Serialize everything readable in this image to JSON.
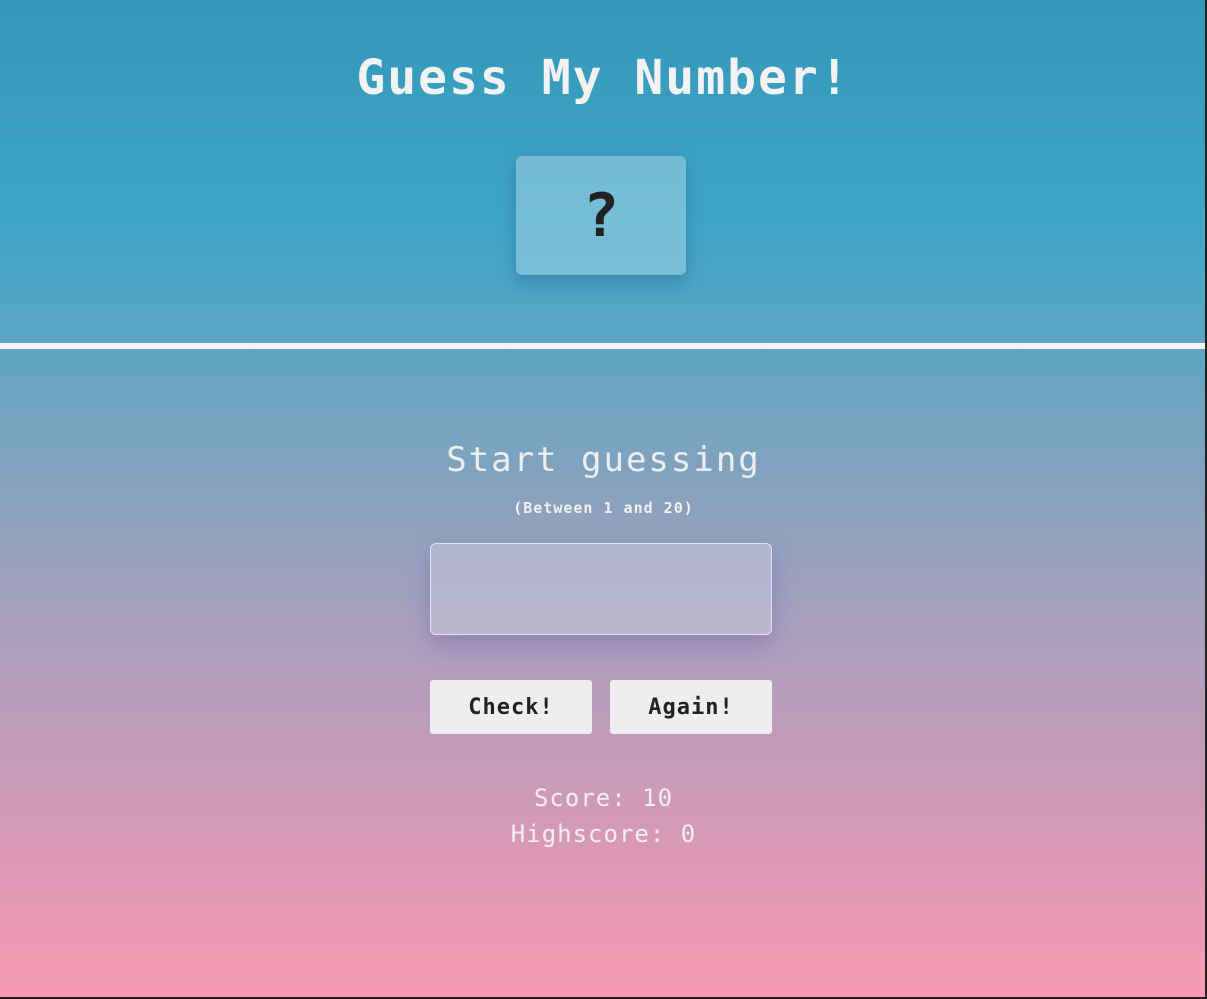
{
  "header": {
    "title": "Guess My Number!",
    "secret_number_display": "?"
  },
  "main": {
    "message": "Start guessing",
    "range_hint": "(Between 1 and 20)",
    "guess_input": {
      "value": "",
      "placeholder": ""
    },
    "buttons": {
      "check_label": "Check!",
      "again_label": "Again!"
    },
    "stats": {
      "score_label": "Score:",
      "score_value": "10",
      "highscore_label": "Highscore:",
      "highscore_value": "0"
    }
  },
  "colors": {
    "gradient_top": "#3498b8",
    "gradient_bottom": "#f89ab3",
    "text": "#eeeeee",
    "button_bg": "#eeeeee",
    "button_text": "#222222"
  }
}
